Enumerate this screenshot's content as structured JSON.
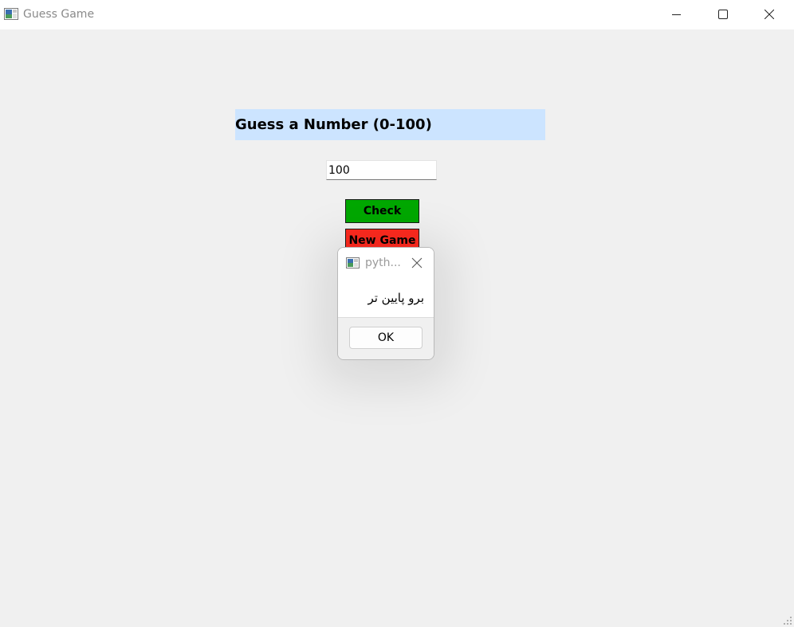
{
  "window": {
    "title": "Guess Game",
    "icons": {
      "app": "tk-app-icon",
      "minimize": "minimize-icon",
      "maximize": "maximize-icon",
      "close": "close-icon"
    }
  },
  "main": {
    "heading": "Guess a Number (0-100)",
    "guess_value": "100",
    "check_label": "Check",
    "new_game_label": "New Game",
    "colors": {
      "heading_bg": "#cce4ff",
      "check_bg": "#00a800",
      "new_game_bg": "#ff2a1f"
    }
  },
  "dialog": {
    "title": "pyth...",
    "message": "برو پایین تر",
    "ok_label": "OK",
    "icons": {
      "app": "tk-app-icon",
      "close": "close-icon"
    }
  }
}
